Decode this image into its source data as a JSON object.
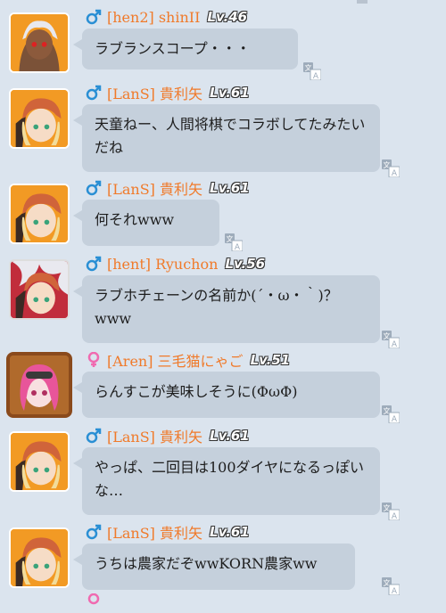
{
  "colors": {
    "name_orange": "#f07a2a",
    "male_blue": "#2a8fd4",
    "female_pink": "#f06ab0",
    "bubble": "#c5d0dc",
    "background": "#dbe4ee"
  },
  "messages": [
    {
      "gender": "male",
      "name": "[hen2] shinII",
      "level": "Lv.46",
      "text": "ラブランスコープ・・・",
      "avatar": "avatar-silver-hair-girl"
    },
    {
      "gender": "male",
      "name": "[LanS] 貴利矢",
      "level": "Lv.61",
      "text": "天童ねー、人間将棋でコラボしてたみたいだね",
      "avatar": "avatar-blonde-hat-girl"
    },
    {
      "gender": "male",
      "name": "[LanS] 貴利矢",
      "level": "Lv.61",
      "text": "何それwww",
      "avatar": "avatar-blonde-hat-girl"
    },
    {
      "gender": "male",
      "name": "[hent] Ryuchon",
      "level": "Lv.56",
      "text": "ラブホチェーンの名前か(´・ω・｀)？www",
      "avatar": "avatar-blonde-hat-girl-white-frame"
    },
    {
      "gender": "female",
      "name": "[Aren] 三毛猫にゃご",
      "level": "Lv.51",
      "text": "らんすこが美味しそうに(ΦωΦ)",
      "avatar": "avatar-pink-hair-girl-wood-frame"
    },
    {
      "gender": "male",
      "name": "[LanS] 貴利矢",
      "level": "Lv.61",
      "text": "やっぱ、二回目は100ダイヤになるっぽいな…",
      "avatar": "avatar-blonde-hat-girl"
    },
    {
      "gender": "male",
      "name": "[LanS] 貴利矢",
      "level": "Lv.61",
      "text": "うちは農家だぞwwKORN農家ww",
      "avatar": "avatar-blonde-hat-girl"
    }
  ]
}
